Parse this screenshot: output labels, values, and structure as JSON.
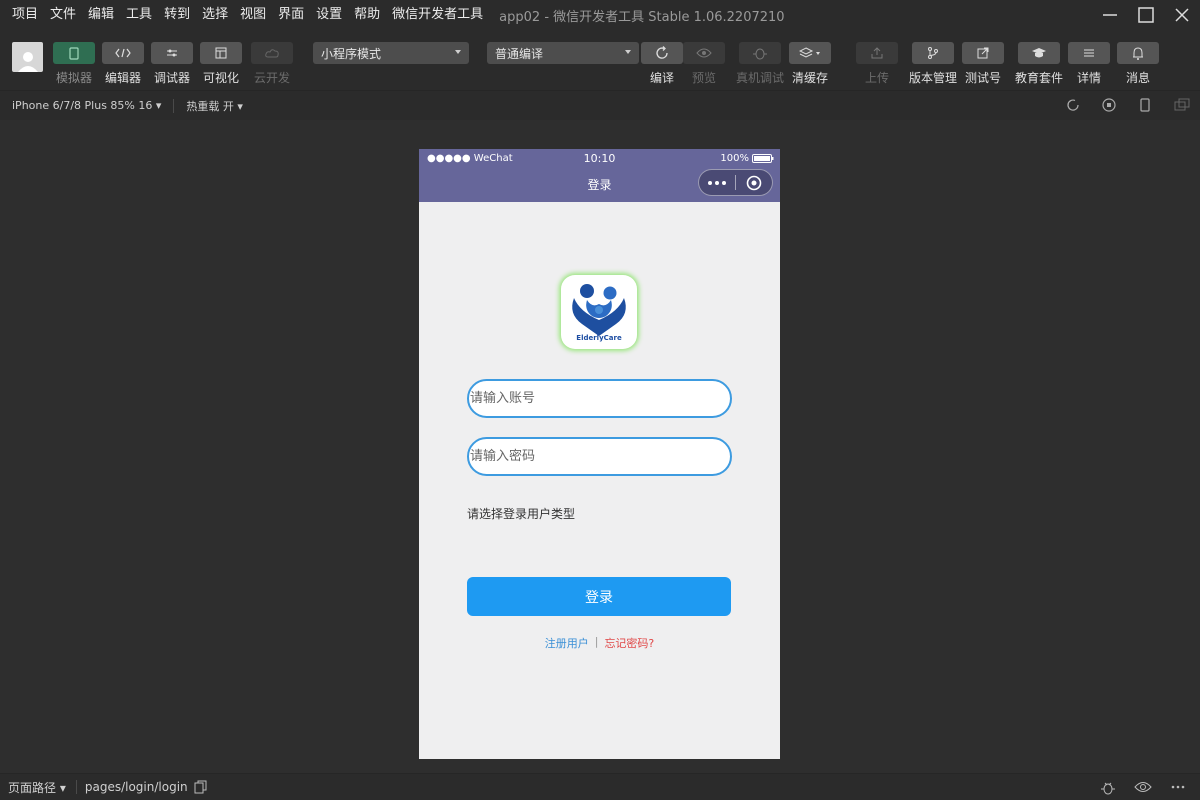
{
  "menu": [
    "项目",
    "文件",
    "编辑",
    "工具",
    "转到",
    "选择",
    "视图",
    "界面",
    "设置",
    "帮助",
    "微信开发者工具"
  ],
  "window_title": "app02 - 微信开发者工具 Stable 1.06.2207210",
  "toolbar": {
    "simulator": "模拟器",
    "editor": "编辑器",
    "debugger": "调试器",
    "visual": "可视化",
    "cloud": "云开发",
    "mode_select": "小程序模式",
    "compile_select": "普通编译",
    "compile": "编译",
    "preview": "预览",
    "remote_debug": "真机调试",
    "clear_cache": "清缓存",
    "upload": "上传",
    "version": "版本管理",
    "test_account": "测试号",
    "edu": "教育套件",
    "details": "详情",
    "messages": "消息"
  },
  "subbar": {
    "device": "iPhone 6/7/8 Plus 85% 16",
    "hot_reload": "热重载 开"
  },
  "phone": {
    "carrier": "●●●●● WeChat",
    "time": "10:10",
    "battery": "100%",
    "nav_title": "登录",
    "logo_text": "ElderlyCare",
    "account_placeholder": "请输入账号",
    "password_placeholder": "请输入密码",
    "user_type_label": "请选择登录用户类型",
    "login_button": "登录",
    "register_link": "注册用户",
    "link_separator": "|",
    "forgot_link": "忘记密码?"
  },
  "bottombar": {
    "page_path_label": "页面路径",
    "page_path": "pages/login/login"
  },
  "colors": {
    "nav_bg": "#66669a",
    "primary": "#1e9af2",
    "field_border": "#3d9be0",
    "forgot": "#e04848"
  }
}
